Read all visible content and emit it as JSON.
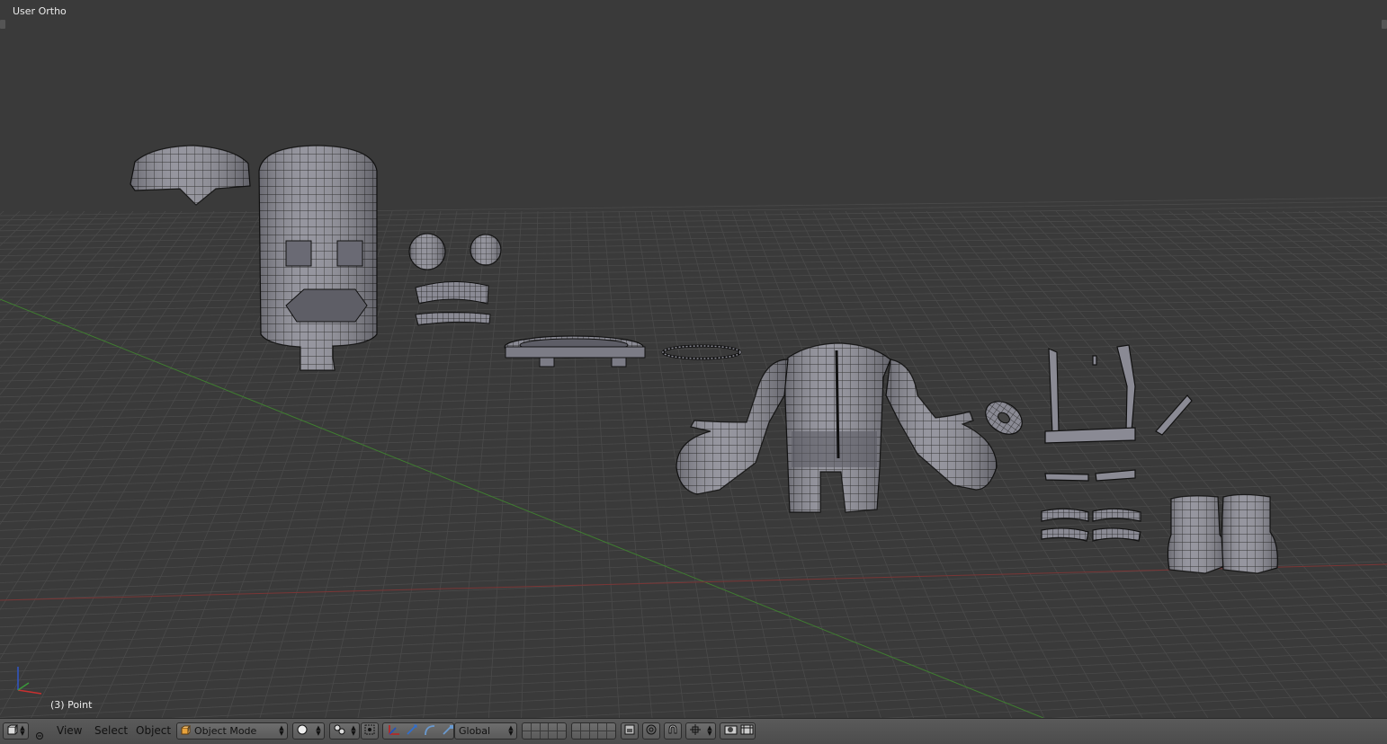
{
  "viewport": {
    "view_name": "User Ortho",
    "object_info": "(3) Point"
  },
  "header": {
    "editor_type_icon": "view3d-cube-icon",
    "collapse_icon": "collapse-menu-icon",
    "menus": [
      "View",
      "Select",
      "Object"
    ],
    "mode": {
      "icon": "object-mode-cube-icon",
      "label": "Object Mode"
    },
    "shading": {
      "icon": "solid-sphere-icon"
    },
    "pivot": {
      "icon": "pivot-point-icon"
    },
    "manipulator_toggle": {
      "icon": "manipulator-toggle-icon"
    },
    "transform_tools": [
      "translate-arrow-icon",
      "rotate-arc-icon",
      "scale-icon"
    ],
    "orientation": {
      "label": "Global"
    },
    "layers": {
      "rows": 2,
      "cols": 10
    },
    "layer_lock_icon": "layer-lock-icon",
    "proportional_icon": "proportional-edit-icon",
    "snap_icon": "magnet-snap-icon",
    "snap_target_icon": "snap-target-icon",
    "render_icons": [
      "opengl-render-icon",
      "opengl-anim-icon"
    ]
  },
  "colors": {
    "viewport_bg": "#3a3a3a",
    "grid": "#4a4a4a",
    "x_axis": "#8c3a3a",
    "y_axis": "#3f7d30",
    "header_bg": "#535353",
    "mesh_fill": "#8e8e98",
    "mesh_wire": "#1a1a1a"
  }
}
